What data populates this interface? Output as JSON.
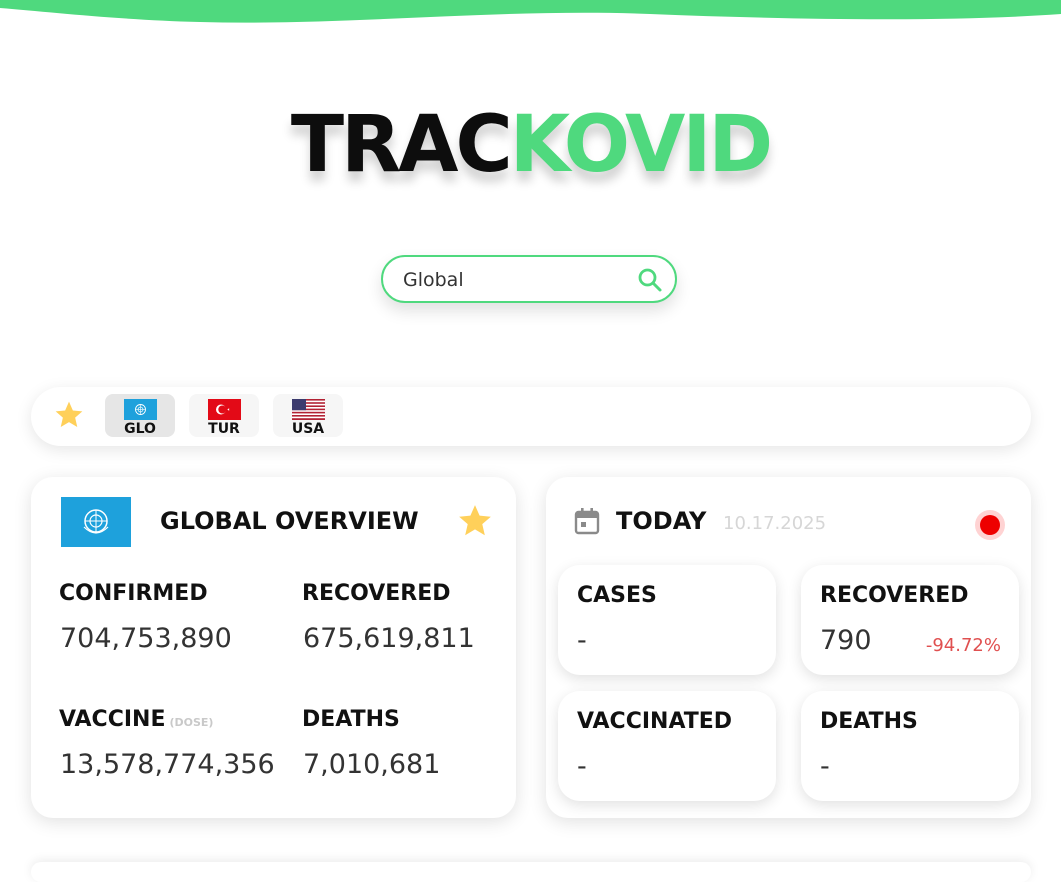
{
  "colors": {
    "accent": "#4fd97e",
    "star": "#ffd05a",
    "negative": "#e05050",
    "live": "#ee0000"
  },
  "logo": {
    "part1": "TRAC",
    "part2": "KOVID"
  },
  "search": {
    "value": "Global",
    "icon": "search-icon"
  },
  "favorites": {
    "star_icon": "star-icon",
    "items": [
      {
        "code": "GLO",
        "flag": "un-flag",
        "active": true
      },
      {
        "code": "TUR",
        "flag": "turkey-flag",
        "active": false
      },
      {
        "code": "USA",
        "flag": "usa-flag",
        "active": false
      }
    ]
  },
  "overview": {
    "title": "GLOBAL OVERVIEW",
    "confirmed_label": "CONFIRMED",
    "confirmed_value": "704,753,890",
    "recovered_label": "RECOVERED",
    "recovered_value": "675,619,811",
    "vaccine_label": "VACCINE",
    "vaccine_sub": "(DOSE)",
    "vaccine_value": "13,578,774,356",
    "deaths_label": "DEATHS",
    "deaths_value": "7,010,681"
  },
  "today": {
    "title": "TODAY",
    "date": "10.17.2025",
    "cases_label": "CASES",
    "cases_value": "-",
    "recovered_label": "RECOVERED",
    "recovered_value": "790",
    "recovered_change": "-94.72%",
    "vaccinated_label": "VACCINATED",
    "vaccinated_value": "-",
    "deaths_label": "DEATHS",
    "deaths_value": "-"
  }
}
